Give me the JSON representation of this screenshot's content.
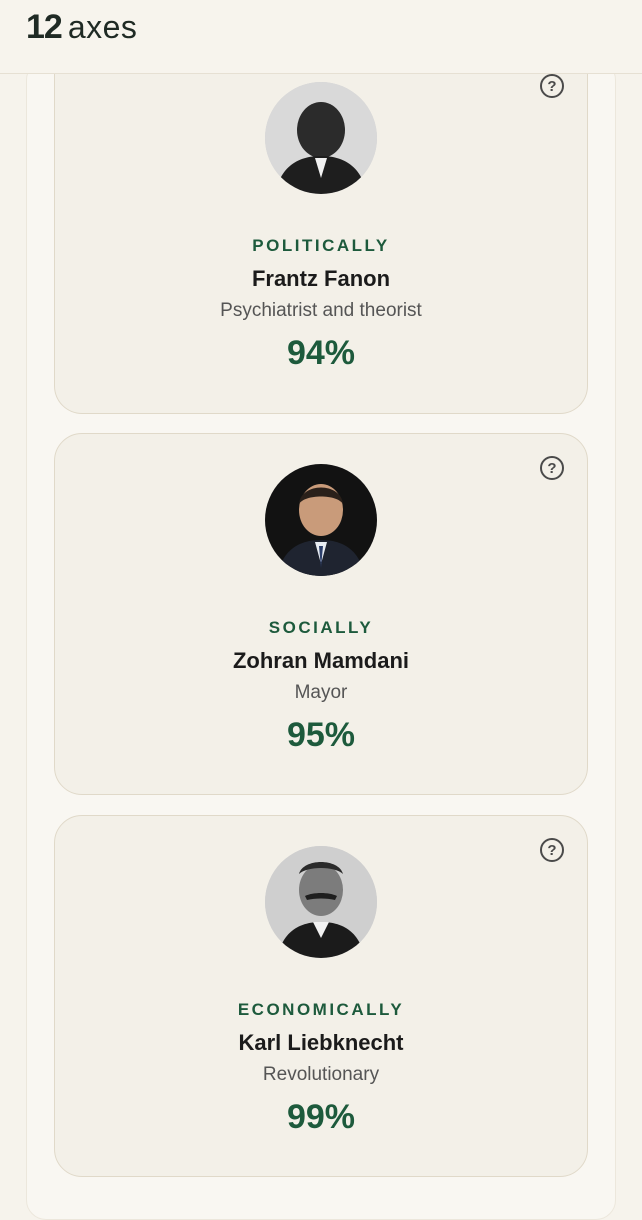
{
  "app": {
    "logo_number": "12",
    "logo_word": "axes"
  },
  "cards": [
    {
      "category": "POLITICALLY",
      "name": "Frantz Fanon",
      "role": "Psychiatrist and theorist",
      "match": "94%",
      "help_icon": "question-circle-icon"
    },
    {
      "category": "SOCIALLY",
      "name": "Zohran Mamdani",
      "role": "Mayor",
      "match": "95%",
      "help_icon": "question-circle-icon"
    },
    {
      "category": "ECONOMICALLY",
      "name": "Karl Liebknecht",
      "role": "Revolutionary",
      "match": "99%",
      "help_icon": "question-circle-icon"
    }
  ],
  "colors": {
    "accent": "#1d5a3c",
    "background": "#f6f3ec",
    "card": "#f3f0e8"
  }
}
